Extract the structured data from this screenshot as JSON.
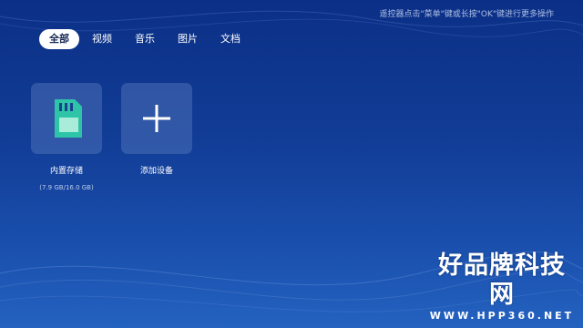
{
  "hint": "遥控器点击\"菜单\"键或长按\"OK\"键进行更多操作",
  "tabs": [
    {
      "label": "全部",
      "active": true
    },
    {
      "label": "视频",
      "active": false
    },
    {
      "label": "音乐",
      "active": false
    },
    {
      "label": "图片",
      "active": false
    },
    {
      "label": "文档",
      "active": false
    }
  ],
  "devices": [
    {
      "label": "内置存储",
      "sub": "(7.9 GB/16.0 GB)",
      "icon": "sd-card-icon"
    },
    {
      "label": "添加设备",
      "icon": "plus-icon"
    }
  ],
  "watermark": {
    "main": "好品牌科技网",
    "url": "WWW.HPP360.NET"
  },
  "colors": {
    "accent": "#2ec4a8",
    "background": "#123e98",
    "tile": "#4a6fb4"
  }
}
